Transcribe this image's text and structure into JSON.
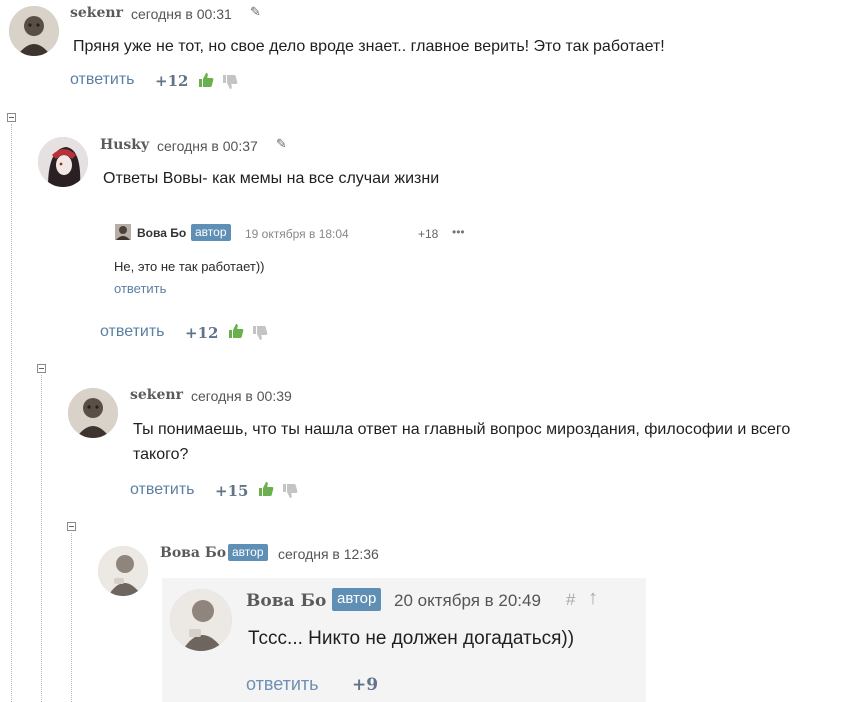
{
  "comments": [
    {
      "username": "sekenr",
      "datetime": "сегодня в 00:31",
      "text": "Пряня уже не тот, но свое дело вроде знает.. главное верить! Это так работает!",
      "reply_label": "ответить",
      "rating": "+12"
    },
    {
      "username": "Husky",
      "datetime": "сегодня в 00:37",
      "text": "Ответы Вовы- как мемы на все случаи жизни",
      "reply_label": "ответить",
      "rating": "+12",
      "embedded": {
        "username": "Вова Бо",
        "badge": "автор",
        "datetime": "19 октября в 18:04",
        "rating": "+18",
        "more": "•••",
        "text": "Не, это не так работает))",
        "reply_label": "ответить"
      }
    },
    {
      "username": "sekenr",
      "datetime": "сегодня в 00:39",
      "text_line1": "Ты понимаешь, что ты нашла ответ на главный вопрос мироздания, философии и всего",
      "text_line2": "такого?",
      "reply_label": "ответить",
      "rating": "+15"
    },
    {
      "username": "Вова Бо",
      "badge": "автор",
      "datetime": "сегодня в 12:36",
      "embedded": {
        "username": "Вова Бо",
        "badge": "автор",
        "datetime": "20 октября в 20:49",
        "hash": "#",
        "arrow": "↑",
        "text": "Тссс... Никто не должен догадаться))",
        "reply_label": "ответить",
        "rating": "+9"
      }
    }
  ],
  "icons": {
    "edit": "pencil-icon",
    "upvote": "thumbs-up-icon",
    "downvote": "thumbs-down-icon",
    "collapse": "collapse-minus-icon",
    "upvote_color": "#6ab04c",
    "downvote_color": "#c4c4c4"
  }
}
